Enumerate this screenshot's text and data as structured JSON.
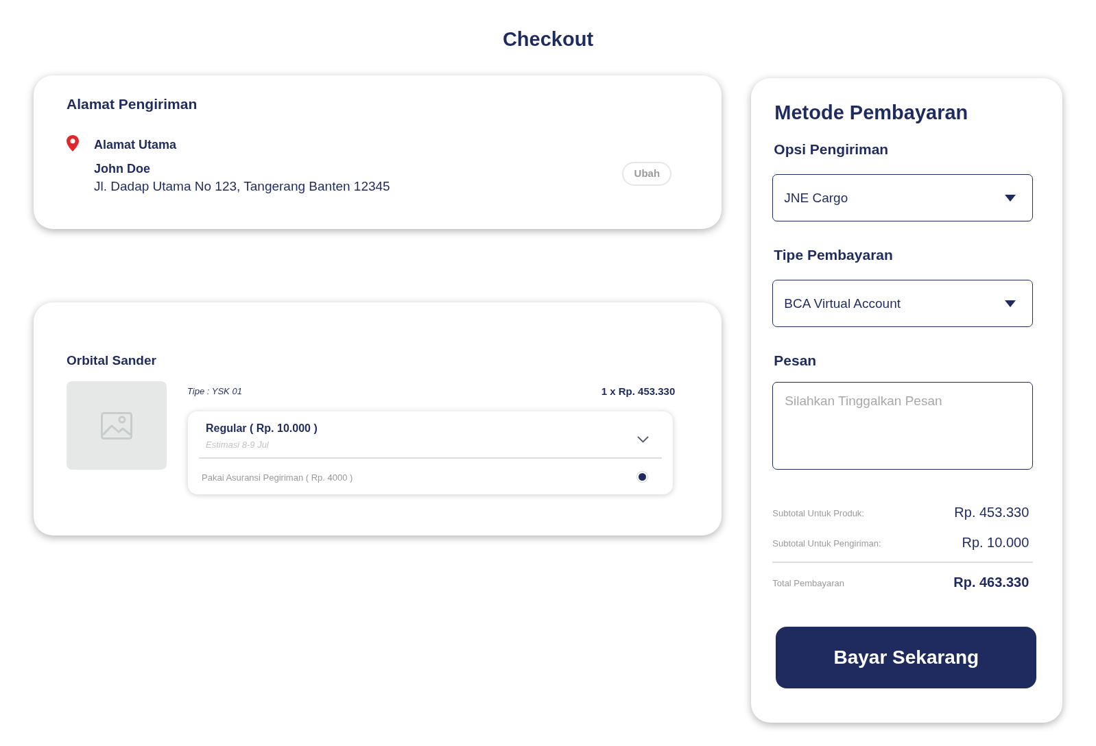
{
  "page": {
    "title": "Checkout"
  },
  "address_card": {
    "heading": "Alamat Pengiriman",
    "label": "Alamat Utama",
    "recipient": "John Doe",
    "address": "Jl. Dadap Utama No 123, Tangerang Banten 12345",
    "change_button": "Ubah"
  },
  "order_card": {
    "product_name": "Orbital Sander",
    "variant": "Tipe : YSK 01",
    "quantity_price": "1 x Rp. 453.330",
    "shipping_option": {
      "name": "Regular ( Rp. 10.000 )",
      "estimate": "Estimasi 8-9 Jul"
    },
    "insurance": {
      "label": "Pakai Asuransi Pegiriman ( Rp. 4000 )",
      "checked": true
    }
  },
  "payment_panel": {
    "title": "Metode Pembayaran",
    "fields": [
      {
        "kind": "select",
        "label": "Opsi Pengiriman",
        "value": "JNE Cargo"
      },
      {
        "kind": "select",
        "label": "Tipe Pembayaran",
        "value": "BCA Virtual Account"
      },
      {
        "kind": "textarea",
        "label": "Pesan",
        "placeholder": "Silahkan Tinggalkan Pesan"
      }
    ],
    "summary": [
      {
        "kind": "subtotal",
        "label": "Subtotal Untuk Produk:",
        "value": "Rp. 453.330"
      },
      {
        "kind": "subtotal",
        "label": "Subtotal Untuk Pengiriman:",
        "value": "Rp. 10.000"
      },
      {
        "kind": "total",
        "label": "Total Pembayaran",
        "value": "Rp. 463.330"
      }
    ],
    "pay_button": "Bayar Sekarang"
  }
}
